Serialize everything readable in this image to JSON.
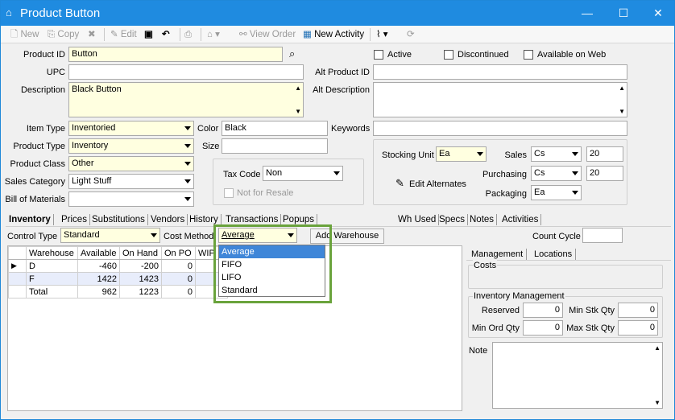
{
  "window": {
    "title": "Product Button",
    "minimize": "—",
    "maximize": "☐",
    "close": "✕"
  },
  "toolbar": {
    "new": "New",
    "copy": "Copy",
    "edit": "Edit",
    "view_order": "View Order",
    "new_activity": "New Activity"
  },
  "fields": {
    "product_id": {
      "label": "Product ID",
      "value": "Button"
    },
    "upc": {
      "label": "UPC",
      "value": ""
    },
    "description": {
      "label": "Description",
      "value": "Black Button"
    },
    "alt_product_id": {
      "label": "Alt Product ID",
      "value": ""
    },
    "alt_description": {
      "label": "Alt Description",
      "value": ""
    },
    "active": {
      "label": "Active"
    },
    "discontinued": {
      "label": "Discontinued"
    },
    "available_on_web": {
      "label": "Available on Web"
    },
    "item_type": {
      "label": "Item Type",
      "value": "Inventoried"
    },
    "product_type": {
      "label": "Product Type",
      "value": "Inventory"
    },
    "product_class": {
      "label": "Product Class",
      "value": "Other"
    },
    "sales_category": {
      "label": "Sales Category",
      "value": "Light Stuff"
    },
    "bill_of_materials": {
      "label": "Bill of Materials",
      "value": ""
    },
    "color": {
      "label": "Color",
      "value": "Black"
    },
    "size": {
      "label": "Size",
      "value": ""
    },
    "keywords": {
      "label": "Keywords",
      "value": ""
    },
    "tax_code": {
      "label": "Tax Code",
      "value": "Non"
    },
    "not_for_resale": {
      "label": "Not for Resale"
    },
    "stocking_unit": {
      "label": "Stocking Unit",
      "value": "Ea"
    },
    "sales": {
      "label": "Sales",
      "unit": "Cs",
      "qty": "20"
    },
    "purchasing": {
      "label": "Purchasing",
      "unit": "Cs",
      "qty": "20"
    },
    "packaging": {
      "label": "Packaging",
      "unit": "Ea"
    },
    "edit_alternates": "Edit Alternates"
  },
  "tabs": [
    "Inventory",
    "Prices",
    "Substitutions",
    "Vendors",
    "History",
    "Transactions",
    "Popups",
    "Wh Used",
    "Specs",
    "Notes",
    "Activities"
  ],
  "inventory": {
    "control_type": {
      "label": "Control Type",
      "value": "Standard"
    },
    "cost_method": {
      "label": "Cost Method",
      "value": "Average",
      "options": [
        "Average",
        "FIFO",
        "LIFO",
        "Standard"
      ]
    },
    "add_warehouse": "Add Warehouse",
    "count_cycle": {
      "label": "Count Cycle",
      "value": ""
    },
    "grid": {
      "columns": [
        "Warehouse",
        "Available",
        "On Hand",
        "On PO",
        "WIP"
      ],
      "rows": [
        [
          "D",
          "-460",
          "-200",
          "0",
          "0"
        ],
        [
          "F",
          "1422",
          "1423",
          "0",
          "0"
        ],
        [
          "Total",
          "962",
          "1223",
          "0",
          "0"
        ]
      ]
    }
  },
  "right_panel": {
    "tabs": [
      "Management",
      "Locations"
    ],
    "costs_label": "Costs",
    "inv_mgmt_label": "Inventory Management",
    "reserved": {
      "label": "Reserved",
      "value": "0"
    },
    "min_stk_qty": {
      "label": "Min Stk Qty",
      "value": "0"
    },
    "min_ord_qty": {
      "label": "Min Ord Qty",
      "value": "0"
    },
    "max_stk_qty": {
      "label": "Max Stk Qty",
      "value": "0"
    },
    "note_label": "Note"
  },
  "colors": {
    "titlebar": "#1f8be0",
    "highlight": "#6aa33c",
    "selected": "#3f86d8",
    "required_field": "#ffffe0"
  }
}
